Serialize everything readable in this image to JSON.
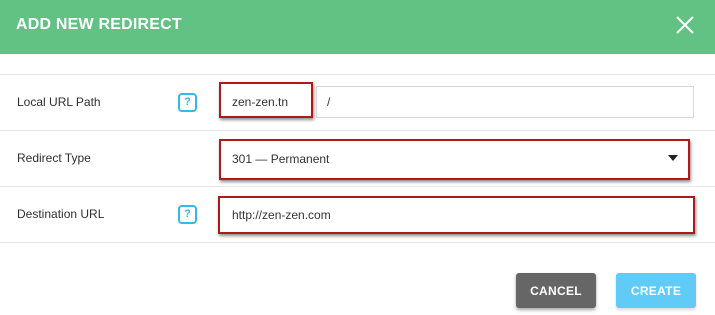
{
  "dialog": {
    "title": "ADD NEW REDIRECT",
    "close_icon": "close-icon"
  },
  "local_url": {
    "label": "Local URL Path",
    "help": "?",
    "domain": "zen-zen.tn",
    "path": "/"
  },
  "redirect_type": {
    "label": "Redirect Type",
    "selected": "301 — Permanent"
  },
  "destination": {
    "label": "Destination URL",
    "help": "?",
    "value": "http://zen-zen.com"
  },
  "actions": {
    "cancel": "CANCEL",
    "create": "CREATE"
  },
  "colors": {
    "header": "#62c283",
    "highlight": "#b01919",
    "help_icon": "#35b9e6",
    "cancel_button": "#666666",
    "create_button": "#5fcbf6"
  }
}
